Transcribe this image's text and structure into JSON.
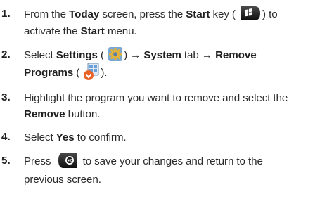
{
  "steps": [
    {
      "num": "1.",
      "l1": {
        "t1": "From the ",
        "b1": "Today",
        "t2": " screen, press the ",
        "b2": "Start",
        "t3": " key (",
        "t4": ") to"
      },
      "l2": {
        "t1": "activate the ",
        "b1": "Start",
        "t2": " menu."
      }
    },
    {
      "num": "2.",
      "l1": {
        "t1": "Select ",
        "b1": "Settings",
        "t2": " (",
        "t3": ") → ",
        "b2": "System",
        "t4": " tab → ",
        "b3": "Remove"
      },
      "l2": {
        "b1": "Programs",
        "t1": " (",
        "t2": ")."
      }
    },
    {
      "num": "3.",
      "l1": {
        "t1": "Highlight the program you want to remove and select the"
      },
      "l2": {
        "b1": "Remove",
        "t1": " button."
      }
    },
    {
      "num": "4.",
      "l1": {
        "t1": "Select ",
        "b1": "Yes",
        "t2": " to confirm."
      }
    },
    {
      "num": "5.",
      "l1": {
        "t1": "Press",
        "t2": " to save your changes and return to the"
      },
      "l2": {
        "t1": "previous screen."
      }
    }
  ],
  "icons": {
    "start_key": "windows-start-key-icon",
    "settings": "settings-gear-icon",
    "remove_programs": "remove-programs-icon",
    "ok_key": "ok-key-icon"
  }
}
